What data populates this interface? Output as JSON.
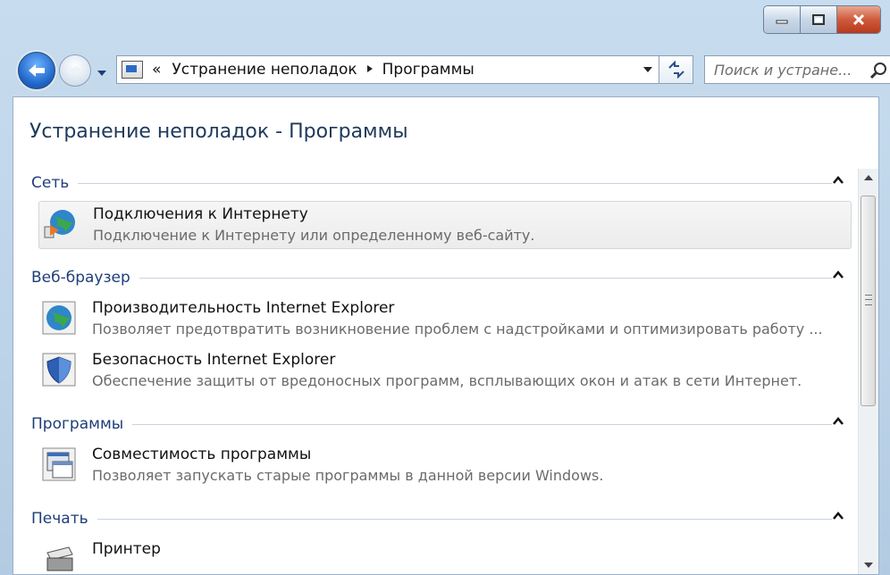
{
  "window": {
    "title": "Устранение неполадок - Программы"
  },
  "address_bar": {
    "breadcrumb_overflow": "«",
    "breadcrumb": [
      "Устранение неполадок",
      "Программы"
    ]
  },
  "search": {
    "placeholder": "Поиск и устране..."
  },
  "sections": [
    {
      "label": "Сеть",
      "items": [
        {
          "title": "Подключения к Интернету",
          "desc": "Подключение к Интернету или определенному веб-сайту.",
          "icon": "network-globe-icon"
        }
      ]
    },
    {
      "label": "Веб-браузер",
      "items": [
        {
          "title": "Производительность Internet Explorer",
          "desc": "Позволяет предотвратить возникновение проблем с надстройками и оптимизировать работу ...",
          "icon": "globe-icon"
        },
        {
          "title": "Безопасность Internet Explorer",
          "desc": "Обеспечение защиты от вредоносных программ, всплывающих окон и атак в сети Интернет.",
          "icon": "shield-icon"
        }
      ]
    },
    {
      "label": "Программы",
      "items": [
        {
          "title": "Совместимость программы",
          "desc": "Позволяет запускать старые программы в данной версии Windows.",
          "icon": "program-compat-icon"
        }
      ]
    },
    {
      "label": "Печать",
      "items": [
        {
          "title": "Принтер",
          "desc": "",
          "icon": "printer-icon"
        }
      ]
    }
  ],
  "colors": {
    "accent": "#1e3e7a",
    "title": "#1e395b"
  }
}
